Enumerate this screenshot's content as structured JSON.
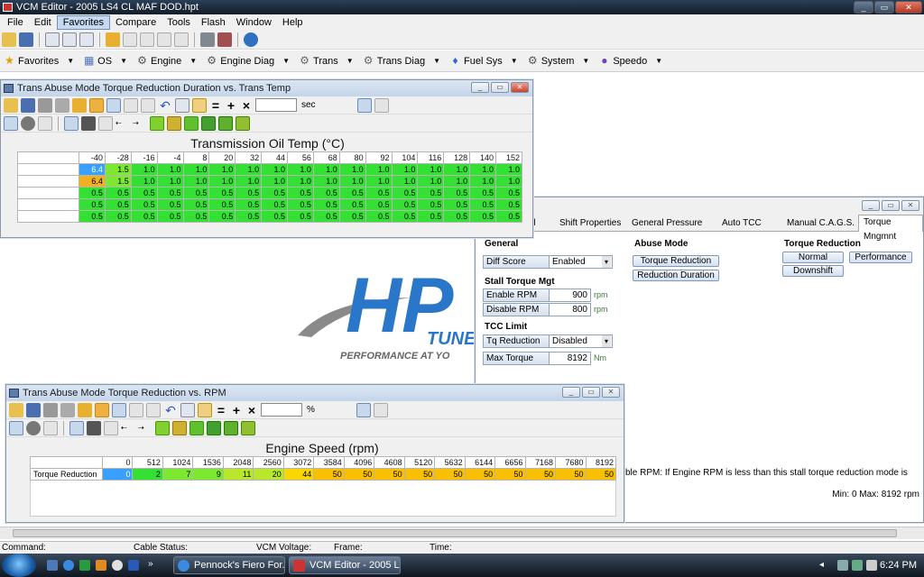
{
  "app": {
    "title": "VCM Editor - 2005 LS4 CL MAF DOD.hpt"
  },
  "menu": [
    "File",
    "Edit",
    "Favorites",
    "Compare",
    "Tools",
    "Flash",
    "Window",
    "Help"
  ],
  "favbar": [
    {
      "label": "Favorites",
      "icon": "star-icon"
    },
    {
      "label": "OS",
      "icon": "os-chip-icon"
    },
    {
      "label": "Engine",
      "icon": "engine-icon"
    },
    {
      "label": "Engine Diag",
      "icon": "engine-diag-icon"
    },
    {
      "label": "Trans",
      "icon": "transmission-icon"
    },
    {
      "label": "Trans Diag",
      "icon": "trans-diag-icon"
    },
    {
      "label": "Fuel Sys",
      "icon": "fuel-drop-icon"
    },
    {
      "label": "System",
      "icon": "system-gear-icon"
    },
    {
      "label": "Speedo",
      "icon": "speedo-icon"
    }
  ],
  "logo": {
    "text": "HP",
    "tune": "TUNE",
    "tagline": "PERFORMANCE AT YO"
  },
  "win1": {
    "title": "Trans Abuse Mode Torque Reduction Duration vs. Trans Temp",
    "unit": "sec",
    "chart_title": "Transmission Oil Temp (°C)",
    "cols": [
      "-40",
      "-28",
      "-16",
      "-4",
      "8",
      "20",
      "32",
      "44",
      "56",
      "68",
      "80",
      "92",
      "104",
      "116",
      "128",
      "140",
      "152"
    ],
    "rows": [
      [
        "6.4",
        "1.5",
        "1.0",
        "1.0",
        "1.0",
        "1.0",
        "1.0",
        "1.0",
        "1.0",
        "1.0",
        "1.0",
        "1.0",
        "1.0",
        "1.0",
        "1.0",
        "1.0",
        "1.0"
      ],
      [
        "6.4",
        "1.5",
        "1.0",
        "1.0",
        "1.0",
        "1.0",
        "1.0",
        "1.0",
        "1.0",
        "1.0",
        "1.0",
        "1.0",
        "1.0",
        "1.0",
        "1.0",
        "1.0",
        "1.0"
      ],
      [
        "0.5",
        "0.5",
        "0.5",
        "0.5",
        "0.5",
        "0.5",
        "0.5",
        "0.5",
        "0.5",
        "0.5",
        "0.5",
        "0.5",
        "0.5",
        "0.5",
        "0.5",
        "0.5",
        "0.5"
      ],
      [
        "0.5",
        "0.5",
        "0.5",
        "0.5",
        "0.5",
        "0.5",
        "0.5",
        "0.5",
        "0.5",
        "0.5",
        "0.5",
        "0.5",
        "0.5",
        "0.5",
        "0.5",
        "0.5",
        "0.5"
      ],
      [
        "0.5",
        "0.5",
        "0.5",
        "0.5",
        "0.5",
        "0.5",
        "0.5",
        "0.5",
        "0.5",
        "0.5",
        "0.5",
        "0.5",
        "0.5",
        "0.5",
        "0.5",
        "0.5",
        "0.5"
      ]
    ]
  },
  "win2": {
    "title": "Trans Abuse Mode Torque Reduction vs. RPM",
    "unit": "%",
    "chart_title": "Engine Speed (rpm)",
    "row_label": "Torque Reduction",
    "cols": [
      "0",
      "512",
      "1024",
      "1536",
      "2048",
      "2560",
      "3072",
      "3584",
      "4096",
      "4608",
      "5120",
      "5632",
      "6144",
      "6656",
      "7168",
      "7680",
      "8192"
    ],
    "values": [
      "0",
      "2",
      "7",
      "9",
      "11",
      "20",
      "44",
      "50",
      "50",
      "50",
      "50",
      "50",
      "50",
      "50",
      "50",
      "50",
      "50"
    ]
  },
  "props": {
    "tabs": [
      "d",
      "Shift Properties",
      "General Pressure",
      "Auto TCC",
      "Manual C.A.G.S.",
      "Torque Mngmnt"
    ],
    "general": {
      "title": "General",
      "diff_score_label": "Diff Score",
      "diff_score_value": "Enabled"
    },
    "stall": {
      "title": "Stall Torque Mgt",
      "enable_label": "Enable RPM",
      "enable_value": "900",
      "enable_unit": "rpm",
      "disable_label": "Disable RPM",
      "disable_value": "800",
      "disable_unit": "rpm"
    },
    "tcc": {
      "title": "TCC Limit",
      "tq_label": "Tq Reduction",
      "tq_value": "Disabled",
      "max_label": "Max Torque",
      "max_value": "8192",
      "max_unit": "Nm"
    },
    "abuse": {
      "title": "Abuse Mode",
      "btn1": "Torque Reduction",
      "btn2": "Reduction Duration"
    },
    "torque_red": {
      "title": "Torque Reduction",
      "normal": "Normal",
      "performance": "Performance",
      "downshift": "Downshift"
    },
    "desc": "ble RPM: If Engine RPM is less than this stall torque reduction mode is",
    "minmax": "Min: 0 Max: 8192 rpm"
  },
  "status": {
    "command": "Command:",
    "cable": "Cable Status:",
    "voltage": "VCM Voltage:",
    "frame": "Frame:",
    "time": "Time:"
  },
  "taskbar": {
    "task1": "Pennock's Fiero For...",
    "task2": "VCM Editor - 2005 L...",
    "clock": "6:24 PM"
  }
}
